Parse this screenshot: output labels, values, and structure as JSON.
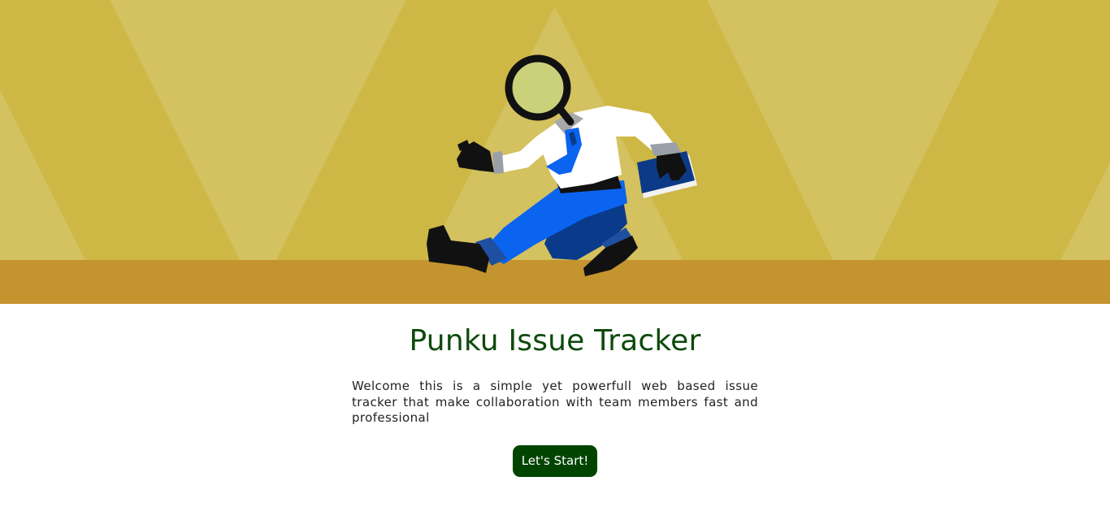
{
  "hero": {
    "illustration": "detective-with-magnifier-illustration",
    "colors": {
      "background": "#d4c05e",
      "stripes": "#cfb846",
      "floor": "#c4942e",
      "shirt": "#ffffff",
      "pants": "#0a64f0",
      "tie": "#0a64f0",
      "folder": "#0d3a86",
      "lens": "#cbd17a"
    }
  },
  "main": {
    "title": "Punku Issue Tracker",
    "description": "Welcome this is a simple yet powerfull web based issue tracker that make collaboration with team members fast and professional",
    "start_button_label": "Let's Start!"
  },
  "theme": {
    "title_color": "#0c4a0c",
    "button_color": "#004400",
    "text_color": "#222222"
  }
}
